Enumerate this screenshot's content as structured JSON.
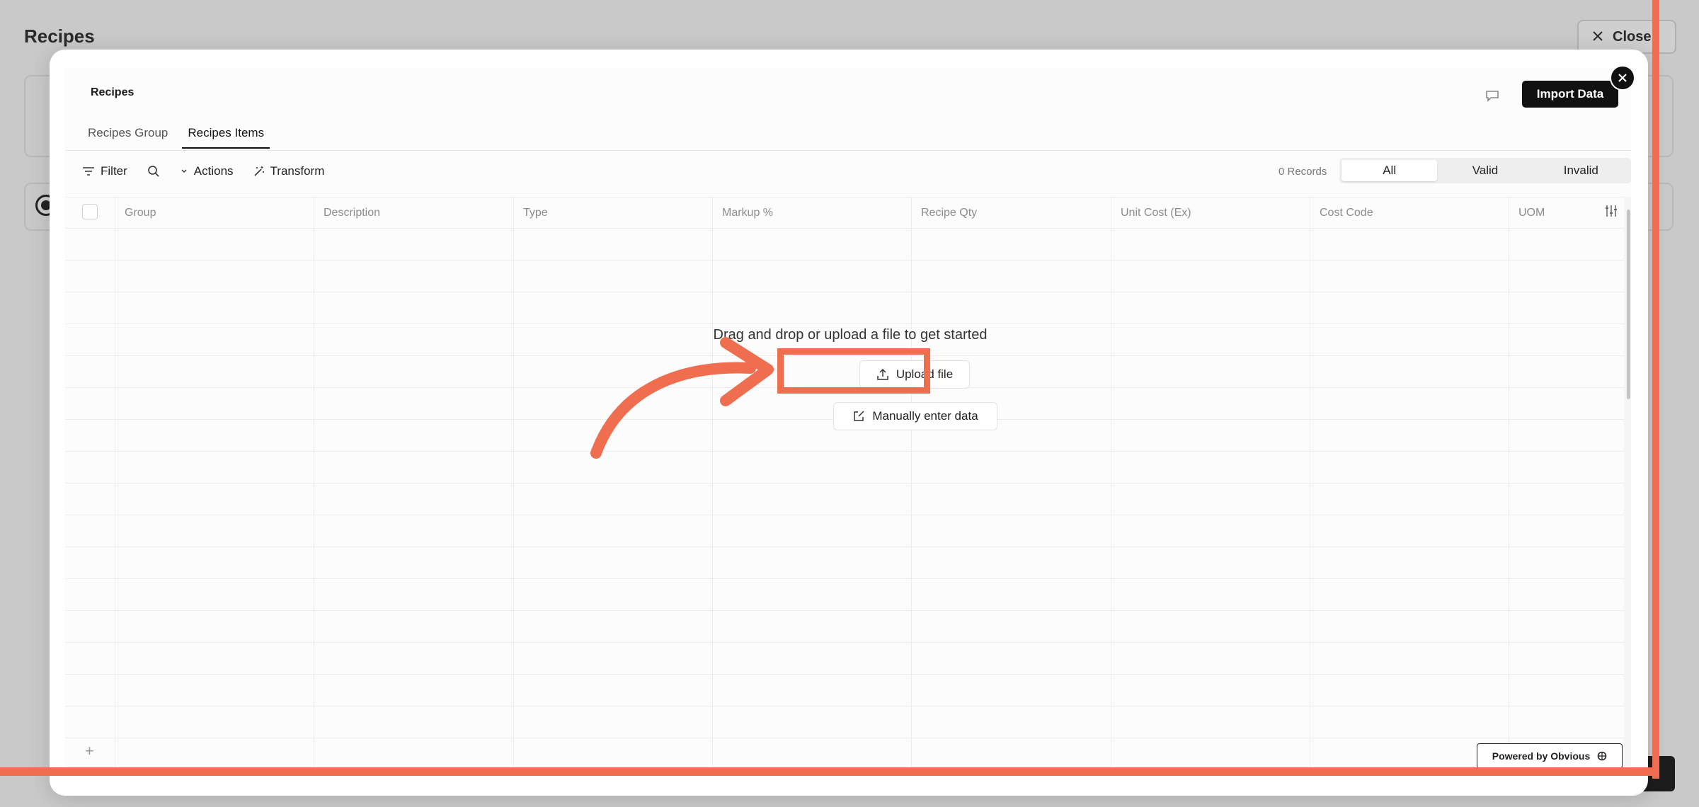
{
  "background": {
    "title": "Recipes",
    "close_label": "Close"
  },
  "modal": {
    "title": "Recipes",
    "import_label": "Import Data",
    "tabs": [
      {
        "label": "Recipes Group",
        "active": false
      },
      {
        "label": "Recipes Items",
        "active": true
      }
    ],
    "toolbar": {
      "filter_label": "Filter",
      "actions_label": "Actions",
      "transform_label": "Transform",
      "records_label": "0 Records",
      "segments": [
        {
          "label": "All",
          "active": true
        },
        {
          "label": "Valid",
          "active": false
        },
        {
          "label": "Invalid",
          "active": false
        }
      ]
    },
    "columns": [
      "Group",
      "Description",
      "Type",
      "Markup %",
      "Recipe Qty",
      "Unit Cost (Ex)",
      "Cost Code",
      "UOM"
    ],
    "empty_message": "Drag and drop or upload a file to get started",
    "upload_label": "Upload file",
    "manual_label": "Manually enter data",
    "add_row_label": "+",
    "powered_label": "Powered by Obvious"
  },
  "colors": {
    "accent": "#ef6e50",
    "primary_button": "#111111"
  }
}
